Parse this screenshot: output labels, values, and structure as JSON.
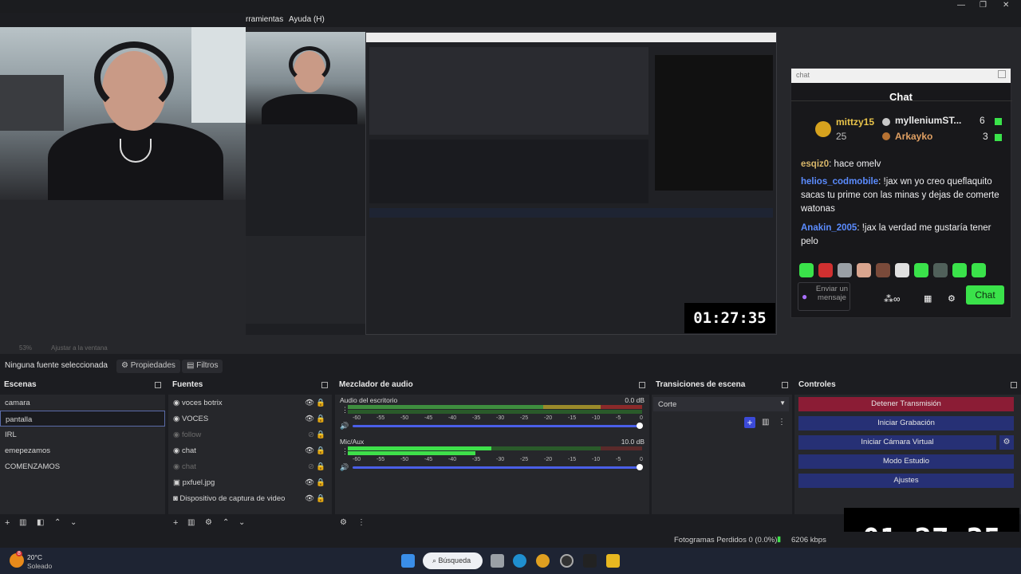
{
  "menu": {
    "tools": "rramientas",
    "help": "Ayuda (H)"
  },
  "chat": {
    "bar_text": "chat",
    "title": "Chat",
    "leader1_name": "mittzy15",
    "leader1_count": "25",
    "leader2_name": "mylleniumST...",
    "leader2_count": "6",
    "leader3_name": "Arkayko",
    "leader3_count": "3",
    "msg0_user": "esqiz0",
    "msg0_text": ": hace omelv",
    "msg1_user": "helios_codmobile",
    "msg1_text": ": !jax wn yo creo queflaquito sacas tu prime con las minas y dejas de comerte watonas",
    "msg2_user": "Anakin_2005",
    "msg2_text": ": !jax la verdad me gustaría tener pelo",
    "input_placeholder": "Enviar un mensaje",
    "send_label": "Chat"
  },
  "timer": {
    "value": "01:27:35"
  },
  "zoom": {
    "level": "53%",
    "fit": "Ajustar a la ventana"
  },
  "props_row": {
    "no_source": "Ninguna fuente seleccionada",
    "properties": "Propiedades",
    "filters": "Filtros"
  },
  "scenes": {
    "title": "Escenas",
    "items": [
      "camara",
      "pantalla",
      "IRL",
      "emepezamos",
      "COMENZAMOS"
    ]
  },
  "sources": {
    "title": "Fuentes",
    "items": [
      "voces botrix",
      "VOCES",
      "follow",
      "chat",
      "chat",
      "pxfuel.jpg",
      "Dispositivo de captura de video"
    ]
  },
  "mixer": {
    "title": "Mezclador de audio",
    "ch1_name": "Audio del escritorio",
    "ch1_db": "0.0 dB",
    "ch2_name": "Mic/Aux",
    "ch2_db": "10.0 dB",
    "ticks": [
      "-60",
      "-55",
      "-50",
      "-45",
      "-40",
      "-35",
      "-30",
      "-25",
      "-20",
      "-15",
      "-10",
      "-5",
      "0"
    ]
  },
  "transitions": {
    "title": "Transiciones de escena",
    "selected": "Corte"
  },
  "controls": {
    "title": "Controles",
    "stop_stream": "Detener Transmisión",
    "start_recording": "Iniciar Grabación",
    "start_vcam": "Iniciar Cámara Virtual",
    "studio_mode": "Modo Estudio",
    "settings": "Ajustes"
  },
  "status": {
    "dropped": "Fotogramas Perdidos 0 (0.0%)",
    "bitrate": "6206 kbps"
  },
  "weather": {
    "temp": "20°C",
    "desc": "Soleado",
    "badge": "8"
  },
  "taskbar": {
    "search": "Búsqueda"
  },
  "colors": {
    "live_red": "#8b1c35",
    "obs_blue": "#263075",
    "chat_green": "#3ae24a",
    "username_blue": "#5b8cff"
  }
}
